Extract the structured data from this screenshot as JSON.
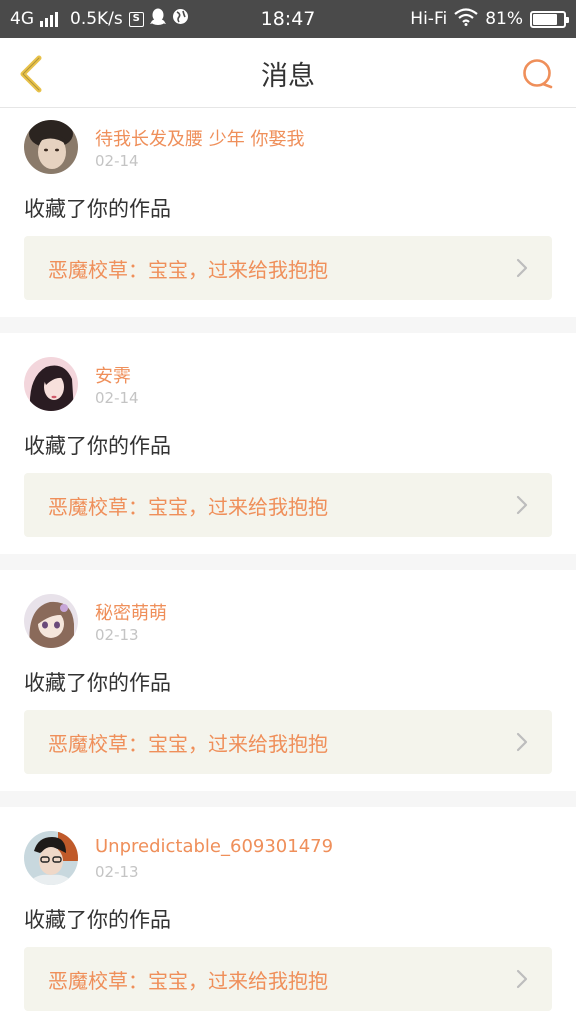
{
  "status_bar": {
    "network": "4G",
    "speed": "0.5K/s",
    "s_badge": "S",
    "time": "18:47",
    "wifi_label": "Hi-Fi",
    "battery_percent": "81%",
    "battery_level": 0.81
  },
  "nav": {
    "title": "消息",
    "back_icon": "chevron-left-icon",
    "search_icon": "search-icon",
    "accent_color": "#ef8f5a",
    "back_color": "#e8c24a"
  },
  "messages": [
    {
      "username": "待我长发及腰 少年 你娶我",
      "date": "02-14",
      "action": "收藏了你的作品",
      "work_title": "恶魔校草：宝宝，过来给我抱抱"
    },
    {
      "username": "安霁",
      "date": "02-14",
      "action": "收藏了你的作品",
      "work_title": "恶魔校草：宝宝，过来给我抱抱"
    },
    {
      "username": "秘密萌萌",
      "date": "02-13",
      "action": "收藏了你的作品",
      "work_title": "恶魔校草：宝宝，过来给我抱抱"
    },
    {
      "username": "Unpredictable_609301479",
      "date": "02-13",
      "action": "收藏了你的作品",
      "work_title": "恶魔校草：宝宝，过来给我抱抱"
    }
  ]
}
